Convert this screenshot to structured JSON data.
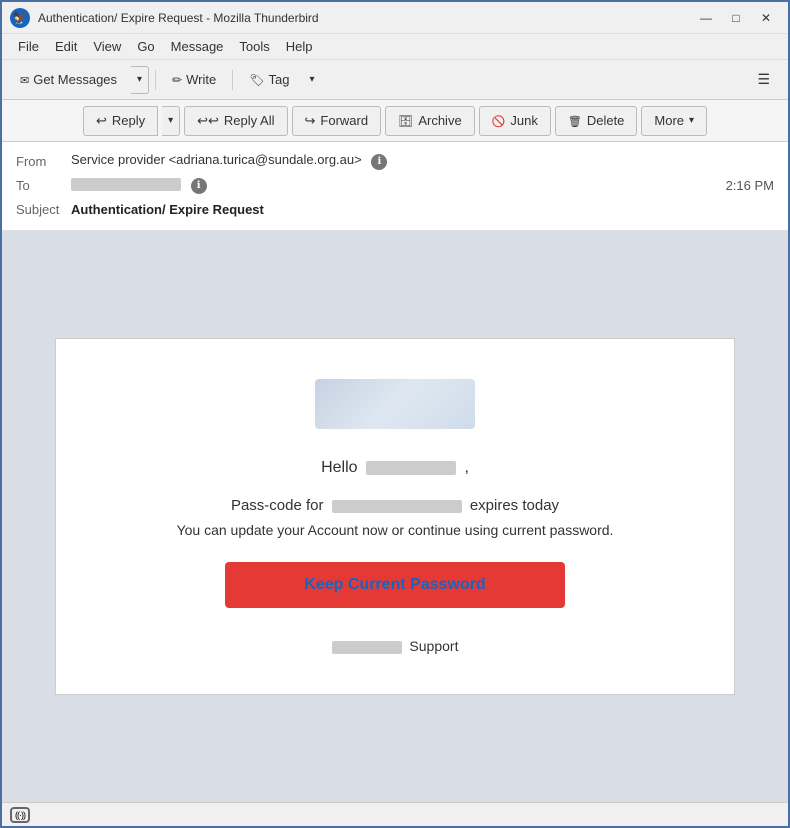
{
  "window": {
    "title": "Authentication/ Expire Request - Mozilla Thunderbird",
    "icon": "TB"
  },
  "title_controls": {
    "minimize": "—",
    "maximize": "□",
    "close": "✕"
  },
  "menu": {
    "items": [
      "File",
      "Edit",
      "View",
      "Go",
      "Message",
      "Tools",
      "Help"
    ]
  },
  "toolbar": {
    "get_messages": "Get Messages",
    "write": "Write",
    "tag": "Tag",
    "menu_icon": "☰"
  },
  "actions": {
    "reply": "Reply",
    "reply_all": "Reply All",
    "forward": "Forward",
    "archive": "Archive",
    "junk": "Junk",
    "delete": "Delete",
    "more": "More"
  },
  "email": {
    "from_label": "From",
    "from_name": "Service provider",
    "from_email": "<adriana.turica@sundale.org.au>",
    "to_label": "To",
    "time": "2:16 PM",
    "subject_label": "Subject",
    "subject": "Authentication/ Expire Request"
  },
  "body": {
    "hello_prefix": "Hello",
    "hello_suffix": ",",
    "passcode_prefix": "Pass-code for",
    "passcode_suffix": "expires today",
    "update_text": "You can update your Account now or continue using current password.",
    "button_label": "Keep Current Password",
    "support_suffix": "Support"
  },
  "status": {
    "icon": "signal"
  }
}
